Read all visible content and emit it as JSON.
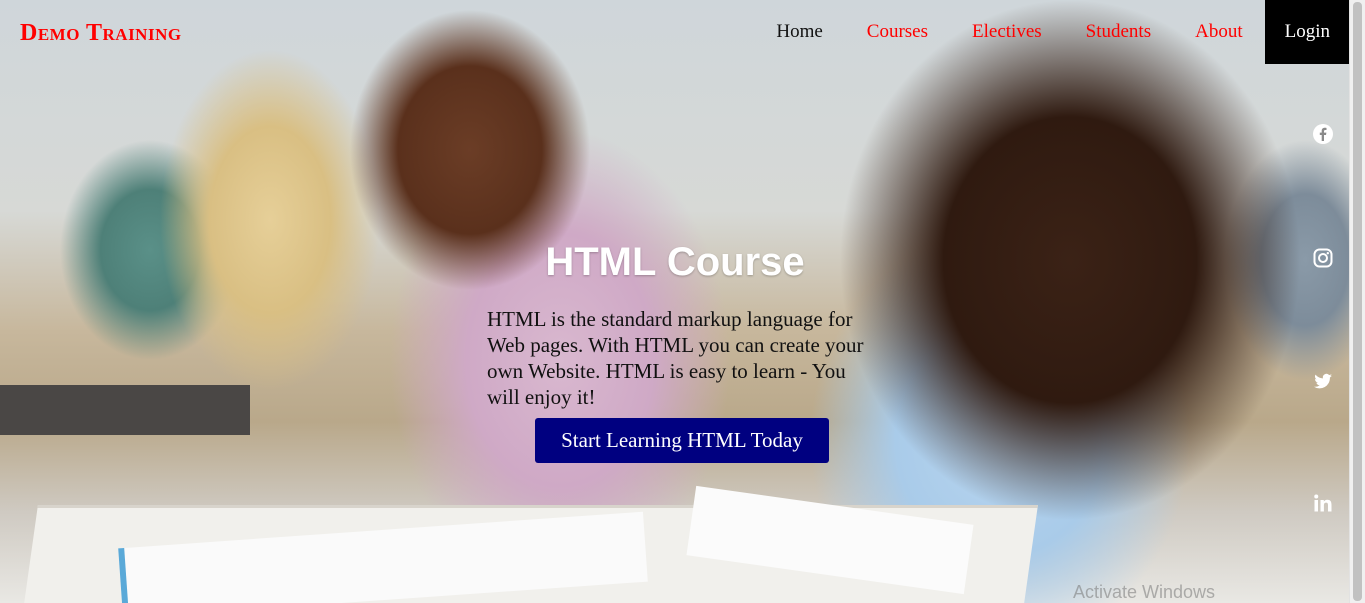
{
  "brand": {
    "text": "Demo Training",
    "color": "#ff0000"
  },
  "nav": {
    "items": [
      {
        "label": "Home",
        "color": "#111111"
      },
      {
        "label": "Courses",
        "color": "#ff0000"
      },
      {
        "label": "Electives",
        "color": "#ff0000"
      },
      {
        "label": "Students",
        "color": "#ff0000"
      },
      {
        "label": "About",
        "color": "#ff0000"
      }
    ],
    "login_label": "Login"
  },
  "hero": {
    "title": "HTML Course",
    "description": "HTML is the standard markup language for Web pages. With HTML you can create your own Website. HTML is easy to learn - You will enjoy it!",
    "cta_label": "Start Learning HTML Today",
    "cta_color": "#000080"
  },
  "social": {
    "icons": [
      "facebook-icon",
      "instagram-icon",
      "twitter-icon",
      "linkedin-icon"
    ]
  },
  "watermark": "Activate Windows"
}
